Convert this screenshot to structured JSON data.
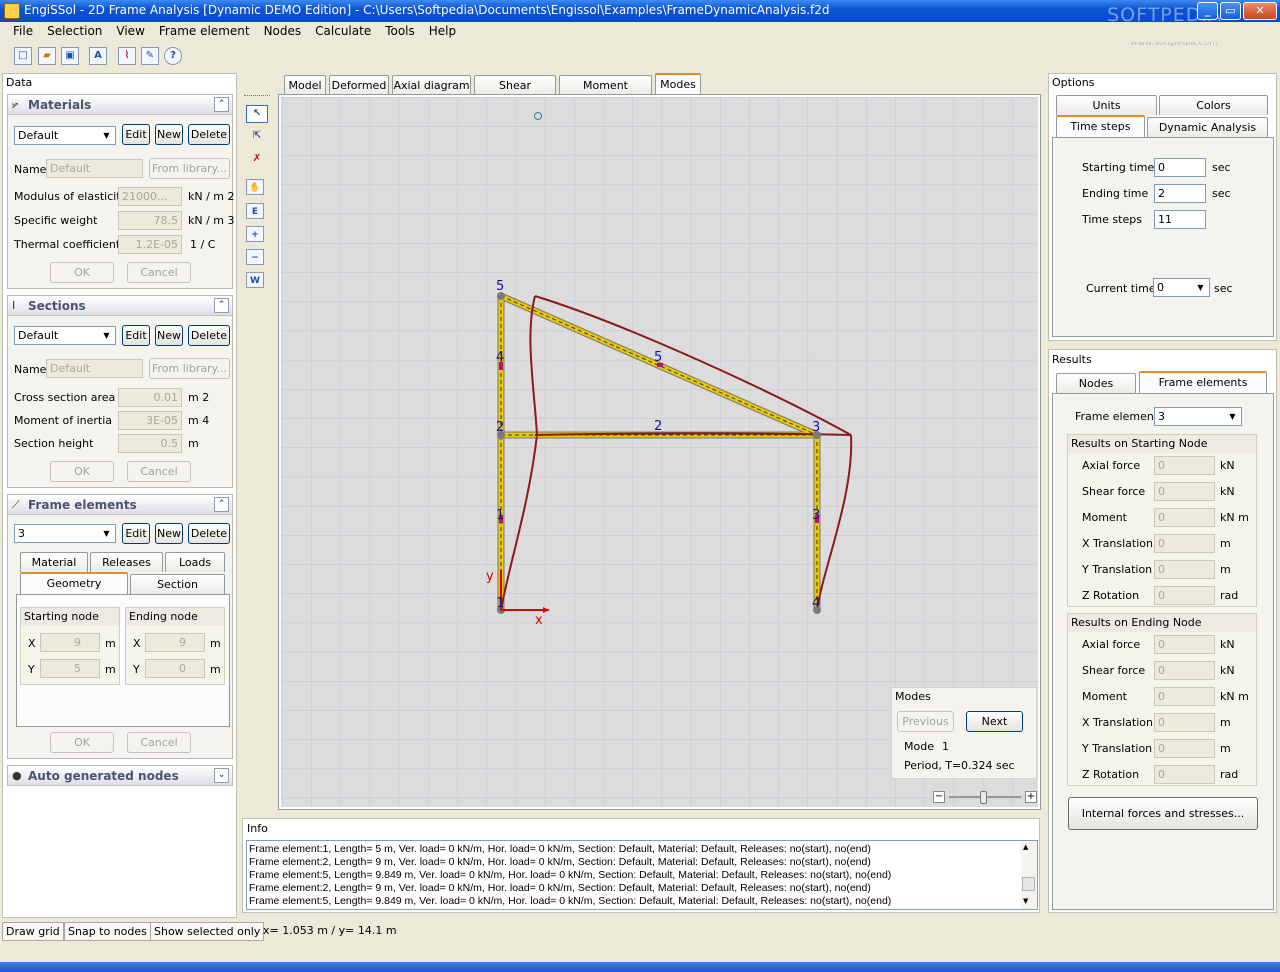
{
  "window": {
    "title": "EngiSSol - 2D Frame Analysis [Dynamic DEMO Edition]   - C:\\Users\\Softpedia\\Documents\\Engissol\\Examples\\FrameDynamicAnalysis.f2d",
    "watermark": "SOFTPEDIA",
    "watermark_url": "www.softpedia.com"
  },
  "menu": [
    "File",
    "Selection",
    "View",
    "Frame element",
    "Nodes",
    "Calculate",
    "Tools",
    "Help"
  ],
  "data_panel": {
    "title": "Data",
    "materials": {
      "header": "Materials",
      "selected": "Default",
      "edit": "Edit",
      "new": "New",
      "delete": "Delete",
      "name_label": "Name",
      "name_value": "Default",
      "from_library": "From library...",
      "rows": [
        {
          "label": "Modulus of elasticity",
          "value": "21000...",
          "unit": "kN  /  m   2"
        },
        {
          "label": "Specific weight",
          "value": "78.5",
          "unit": "kN  /  m   3"
        },
        {
          "label": "Thermal coefficient",
          "value": "1.2E-05",
          "unit": "1    /  C"
        }
      ],
      "ok": "OK",
      "cancel": "Cancel"
    },
    "sections": {
      "header": "Sections",
      "selected": "Default",
      "edit": "Edit",
      "new": "New",
      "delete": "Delete",
      "name_label": "Name",
      "name_value": "Default",
      "from_library": "From library...",
      "rows": [
        {
          "label": "Cross section area",
          "value": "0.01",
          "unit": "m     2"
        },
        {
          "label": "Moment of inertia",
          "value": "3E-05",
          "unit": "m     4"
        },
        {
          "label": "Section height",
          "value": "0.5",
          "unit": "m"
        }
      ],
      "ok": "OK",
      "cancel": "Cancel"
    },
    "frame_elements": {
      "header": "Frame elements",
      "selected": "3",
      "edit": "Edit",
      "new": "New",
      "delete": "Delete",
      "tabs_row1": [
        "Material",
        "Releases",
        "Loads"
      ],
      "tabs_row2": [
        "Geometry",
        "Section"
      ],
      "starting_node": {
        "title": "Starting node",
        "x_label": "X",
        "x_value": "9",
        "y_label": "Y",
        "y_value": "5",
        "unit": "m"
      },
      "ending_node": {
        "title": "Ending node",
        "x_label": "X",
        "x_value": "9",
        "y_label": "Y",
        "y_value": "0",
        "unit": "m"
      },
      "ok": "OK",
      "cancel": "Cancel"
    },
    "auto_nodes": {
      "header": "Auto generated nodes"
    }
  },
  "view_tabs": [
    "Model",
    "Deformed",
    "Axial diagram",
    "Shear diagram",
    "Moment diagram",
    "Modes"
  ],
  "active_view_tab": "Modes",
  "canvas": {
    "node_labels": [
      "1",
      "2",
      "3",
      "4",
      "5"
    ],
    "element_labels": [
      "1",
      "2",
      "3",
      "4",
      "5"
    ],
    "axis_x": "x",
    "axis_y": "y",
    "colors": {
      "grid": "#b7c6db",
      "background": "#dcdcdc",
      "member": "#e8c800",
      "deformed": "#8b1a1a",
      "axis": "#e00000",
      "labels": "#1010a0"
    }
  },
  "modes_box": {
    "title": "Modes",
    "previous": "Previous",
    "next": "Next",
    "mode_label": "Mode",
    "mode_value": "1",
    "period_label": "Period, T=",
    "period_value": "0.324 sec"
  },
  "info": {
    "title": "Info",
    "lines": [
      "Frame element:1, Length= 5 m, Ver. load= 0 kN/m, Hor. load= 0 kN/m, Section: Default, Material: Default, Releases: no(start), no(end)",
      "Frame element:2, Length= 9 m, Ver. load= 0 kN/m, Hor. load= 0 kN/m, Section: Default, Material: Default, Releases: no(start), no(end)",
      "Frame element:5, Length= 9.849 m, Ver. load= 0 kN/m, Hor. load= 0 kN/m, Section: Default, Material: Default, Releases: no(start), no(end)",
      "Frame element:2, Length= 9 m, Ver. load= 0 kN/m, Hor. load= 0 kN/m, Section: Default, Material: Default, Releases: no(start), no(end)",
      "Frame element:5, Length= 9.849 m, Ver. load= 0 kN/m, Hor. load= 0 kN/m, Section: Default, Material: Default, Releases: no(start), no(end)"
    ]
  },
  "options": {
    "title": "Options",
    "tabs_row1": [
      "Units",
      "Colors"
    ],
    "tabs_row2": [
      "Time steps",
      "Dynamic Analysis"
    ],
    "starting_time_label": "Starting time",
    "starting_time": "0",
    "ending_time_label": "Ending time",
    "ending_time": "2",
    "time_steps_label": "Time steps",
    "time_steps": "11",
    "sec": "sec",
    "current_time_label": "Current time",
    "current_time": "0"
  },
  "results": {
    "title": "Results",
    "tabs": [
      "Nodes",
      "Frame elements"
    ],
    "frame_element_label": "Frame element",
    "frame_element": "3",
    "starting": {
      "title": "Results on Starting Node",
      "rows": [
        {
          "label": "Axial force",
          "value": "0",
          "unit": "kN"
        },
        {
          "label": "Shear force",
          "value": "0",
          "unit": "kN"
        },
        {
          "label": "Moment",
          "value": "0",
          "unit": "kN m"
        },
        {
          "label": "X Translation",
          "value": "0",
          "unit": "m"
        },
        {
          "label": "Y Translation",
          "value": "0",
          "unit": "m"
        },
        {
          "label": "Z Rotation",
          "value": "0",
          "unit": "rad"
        }
      ]
    },
    "ending": {
      "title": "Results on Ending Node",
      "rows": [
        {
          "label": "Axial force",
          "value": "0",
          "unit": "kN"
        },
        {
          "label": "Shear force",
          "value": "0",
          "unit": "kN"
        },
        {
          "label": "Moment",
          "value": "0",
          "unit": "kN m"
        },
        {
          "label": "X Translation",
          "value": "0",
          "unit": "m"
        },
        {
          "label": "Y Translation",
          "value": "0",
          "unit": "m"
        },
        {
          "label": "Z Rotation",
          "value": "0",
          "unit": "rad"
        }
      ]
    },
    "internal_forces": "Internal forces and stresses..."
  },
  "statusbar": {
    "draw_grid": "Draw grid",
    "snap": "Snap to nodes",
    "show_selected": "Show selected only",
    "coords": "x= 1.053 m / y= 14.1 m"
  }
}
